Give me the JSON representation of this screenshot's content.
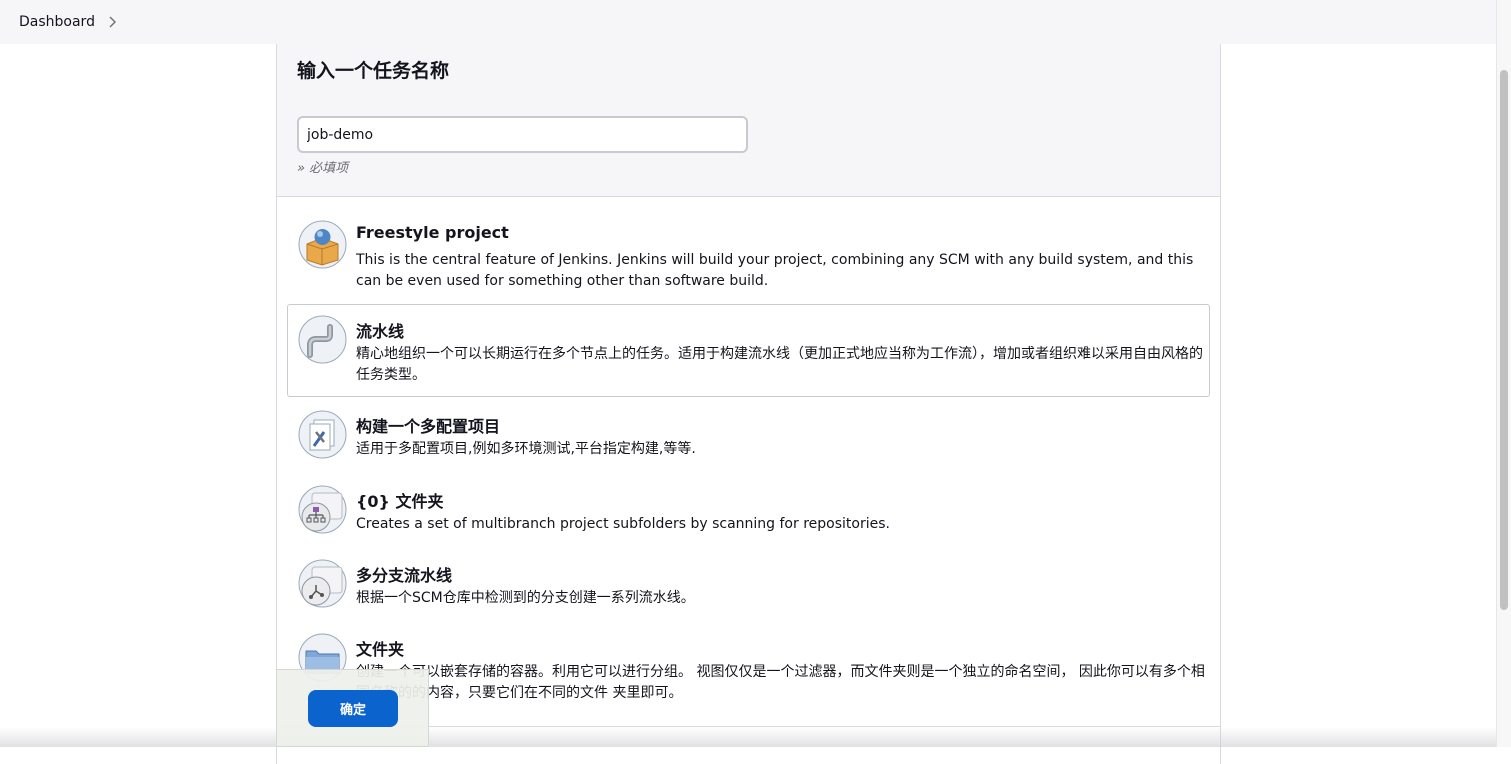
{
  "breadcrumb": {
    "dashboard": "Dashboard"
  },
  "form": {
    "title": "输入一个任务名称",
    "name_value": "job-demo",
    "required_hint": "» 必填项"
  },
  "items": [
    {
      "title": "Freestyle project",
      "desc": "This is the central feature of Jenkins. Jenkins will build your project, combining any SCM with any build system, and this can be even used for something other than software build.",
      "icon": "freestyle-box-icon"
    },
    {
      "title": "流水线",
      "desc": "精心地组织一个可以长期运行在多个节点上的任务。适用于构建流水线（更加正式地应当称为工作流），增加或者组织难以采用自由风格的任务类型。",
      "icon": "pipeline-icon"
    },
    {
      "title": "构建一个多配置项目",
      "desc": "适用于多配置项目,例如多环境测试,平台指定构建,等等.",
      "icon": "multi-config-icon"
    },
    {
      "title": "{0} 文件夹",
      "desc": "Creates a set of multibranch project subfolders by scanning for repositories.",
      "icon": "org-folder-icon"
    },
    {
      "title": "多分支流水线",
      "desc": "根据一个SCM仓库中检测到的分支创建一系列流水线。",
      "icon": "multibranch-icon"
    },
    {
      "title": "文件夹",
      "desc": "创建一个可以嵌套存储的容器。利用它可以进行分组。 视图仅仅是一个过滤器，而文件夹则是一个独立的命名空间， 因此你可以有多个相同名称的的内容，只要它们在不同的文件 夹里即可。",
      "icon": "folder-icon"
    }
  ],
  "confirm": {
    "label": "确定",
    "color": "#0b63ce"
  }
}
